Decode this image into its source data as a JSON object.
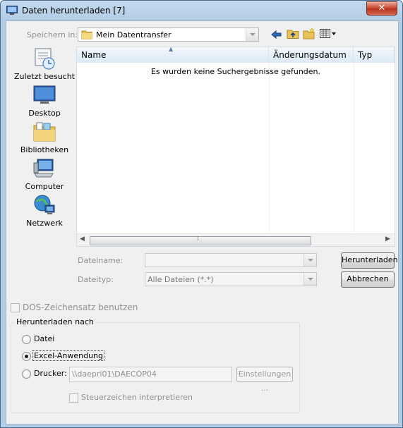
{
  "window": {
    "title": "Daten herunterladen [7]",
    "close_glyph": "✕"
  },
  "save_in": {
    "label": "Speichern in:",
    "value": "Mein Datentransfer"
  },
  "toolbar": {
    "icons": [
      "back-icon",
      "up-folder-icon",
      "new-folder-icon",
      "view-menu-icon"
    ]
  },
  "places": [
    {
      "label": "Zuletzt besucht",
      "icon": "recent-places-icon"
    },
    {
      "label": "Desktop",
      "icon": "desktop-icon"
    },
    {
      "label": "Bibliotheken",
      "icon": "libraries-icon"
    },
    {
      "label": "Computer",
      "icon": "computer-icon"
    },
    {
      "label": "Netzwerk",
      "icon": "network-icon"
    }
  ],
  "file_list": {
    "columns": [
      "Name",
      "Änderungsdatum",
      "Typ"
    ],
    "empty_message": "Es wurden keine Suchergebnisse gefunden."
  },
  "filename": {
    "label": "Dateiname:",
    "value": ""
  },
  "filetype": {
    "label": "Dateityp:",
    "value": "Alle Dateien (*.*)"
  },
  "buttons": {
    "download": "Herunterladen",
    "cancel": "Abbrechen",
    "settings": "Einstellungen ..."
  },
  "dos_charset": {
    "label": "DOS-Zeichensatz benutzen",
    "checked": false
  },
  "download_to": {
    "title": "Herunterladen nach",
    "options": [
      {
        "label": "Datei",
        "selected": false
      },
      {
        "label": "Excel-Anwendung",
        "selected": true
      },
      {
        "label": "Drucker:",
        "selected": false
      }
    ],
    "printer_path": "\\\\daepri01\\DAECOP04",
    "control_chars": {
      "label": "Steuerzeichen interpretieren",
      "checked": false
    }
  }
}
